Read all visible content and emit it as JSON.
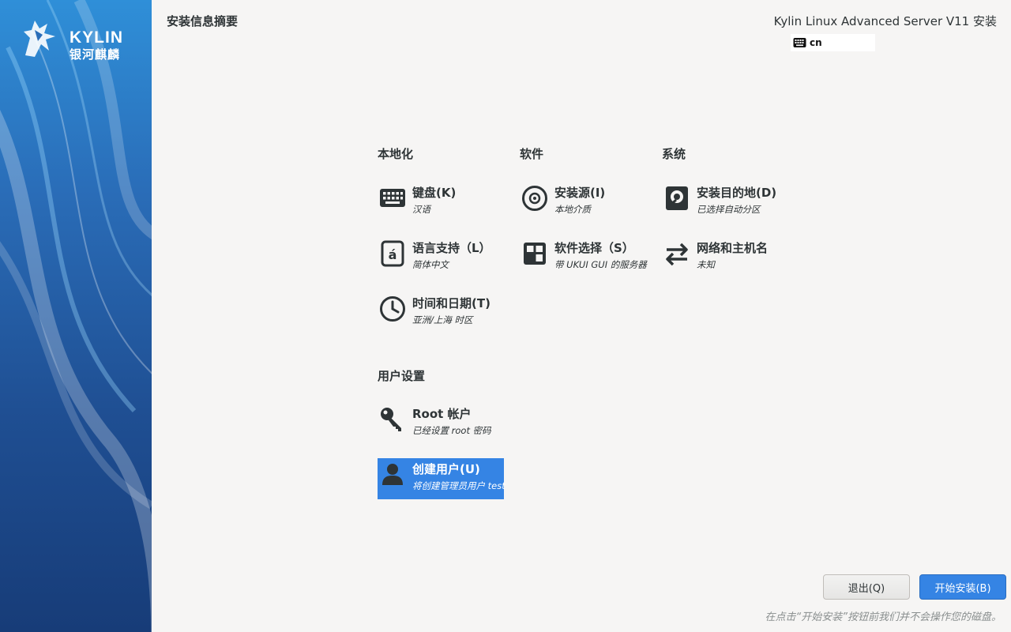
{
  "sidebar": {
    "logo_word": "KYLIN",
    "logo_cn": "银河麒麟"
  },
  "header": {
    "page_title": "安装信息摘要",
    "product_title": "Kylin Linux Advanced Server V11 安装",
    "keyboard_layout": "cn"
  },
  "sections": {
    "localization": "本地化",
    "software": "软件",
    "system": "系统",
    "user_settings": "用户设置"
  },
  "spokes": {
    "keyboard": {
      "name": "键盘(K)",
      "status": "汉语"
    },
    "language": {
      "name": "语言支持（L）",
      "status": "简体中文"
    },
    "datetime": {
      "name": "时间和日期(T)",
      "status": "亚洲/上海 时区"
    },
    "source": {
      "name": "安装源(I)",
      "status": "本地介质"
    },
    "software_selection": {
      "name": "软件选择（S）",
      "status": "带 UKUI GUI 的服务器"
    },
    "destination": {
      "name": "安装目的地(D)",
      "status": "已选择自动分区"
    },
    "network": {
      "name": "网络和主机名",
      "status": "未知"
    },
    "root": {
      "name": "Root 帐户",
      "status": "已经设置 root 密码"
    },
    "user": {
      "name": "创建用户(U)",
      "status": "将创建管理员用户 test"
    }
  },
  "footer": {
    "quit_label": "退出(Q)",
    "begin_label": "开始安装(B)",
    "note": "在点击“开始安装”按钮前我们并不会操作您的磁盘。"
  },
  "colors": {
    "accent": "#3584e4",
    "sidebar_top": "#2f8fd8",
    "sidebar_bottom": "#173c78"
  }
}
